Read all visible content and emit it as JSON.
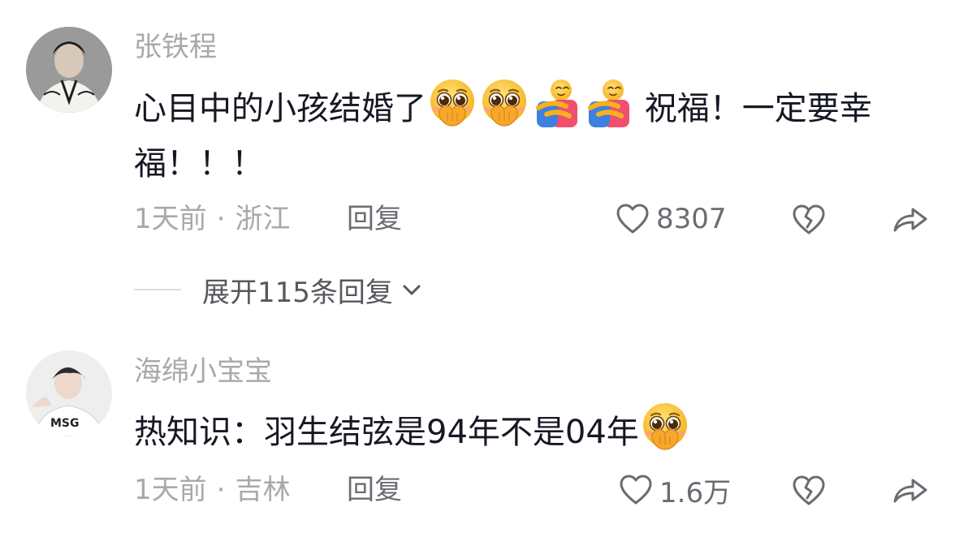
{
  "comments": [
    {
      "username": "张铁程",
      "text_part1": "心目中的小孩结婚了",
      "emojis_part1": [
        "pleading-face-emoji",
        "pleading-face-emoji",
        "hugging-people-emoji",
        "hugging-people-emoji"
      ],
      "text_part2": " 祝福！一定要幸福！！！",
      "time": "1天前",
      "separator": "·",
      "location": "浙江",
      "reply_label": "回复",
      "likes": "8307",
      "expand_label": "展开115条回复"
    },
    {
      "username": "海绵小宝宝",
      "text_part1": "热知识：羽生结弦是94年不是04年",
      "emojis_part1": [
        "pleading-face-emoji"
      ],
      "time": "1天前",
      "separator": "·",
      "location": "吉林",
      "reply_label": "回复",
      "likes": "1.6万"
    }
  ],
  "icons": {
    "like": "heart-outline-icon",
    "dislike": "broken-heart-icon",
    "share": "share-arrow-icon",
    "expand": "chevron-down-icon"
  },
  "colors": {
    "username": "#a8a8ad",
    "text": "#161823",
    "meta": "#a8a8ad",
    "action": "#6b6b72"
  }
}
